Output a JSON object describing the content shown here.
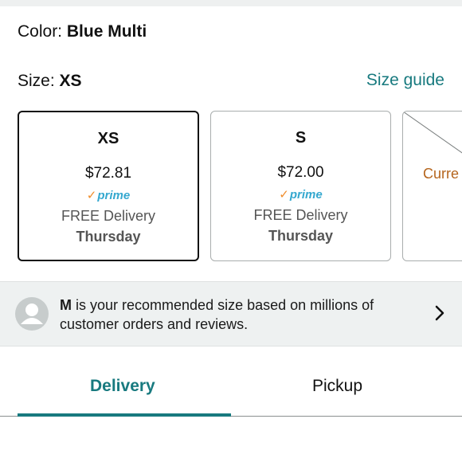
{
  "color": {
    "label": "Color:",
    "value": "Blue Multi"
  },
  "size": {
    "label": "Size:",
    "value": "XS",
    "guide_link": "Size guide"
  },
  "size_options": [
    {
      "size": "XS",
      "price": "$72.81",
      "prime": "prime",
      "delivery": "FREE Delivery",
      "day": "Thursday",
      "selected": true
    },
    {
      "size": "S",
      "price": "$72.00",
      "prime": "prime",
      "delivery": "FREE Delivery",
      "day": "Thursday",
      "selected": false
    },
    {
      "partial_text": "Curre",
      "unavailable": true
    }
  ],
  "recommendation": {
    "size": "M",
    "text": " is your recommended size based on millions of customer orders and reviews."
  },
  "tabs": [
    {
      "label": "Delivery",
      "active": true
    },
    {
      "label": "Pickup",
      "active": false
    }
  ],
  "colors": {
    "accent": "#187a7f",
    "prime_blue": "#35a8cf",
    "prime_check": "#f08c2a",
    "unavailable_text": "#b5651d",
    "panel_bg": "#eef1f1"
  },
  "icons": {
    "avatar": "person-icon",
    "chevron": "chevron-right-icon",
    "prime_check": "check-icon"
  }
}
